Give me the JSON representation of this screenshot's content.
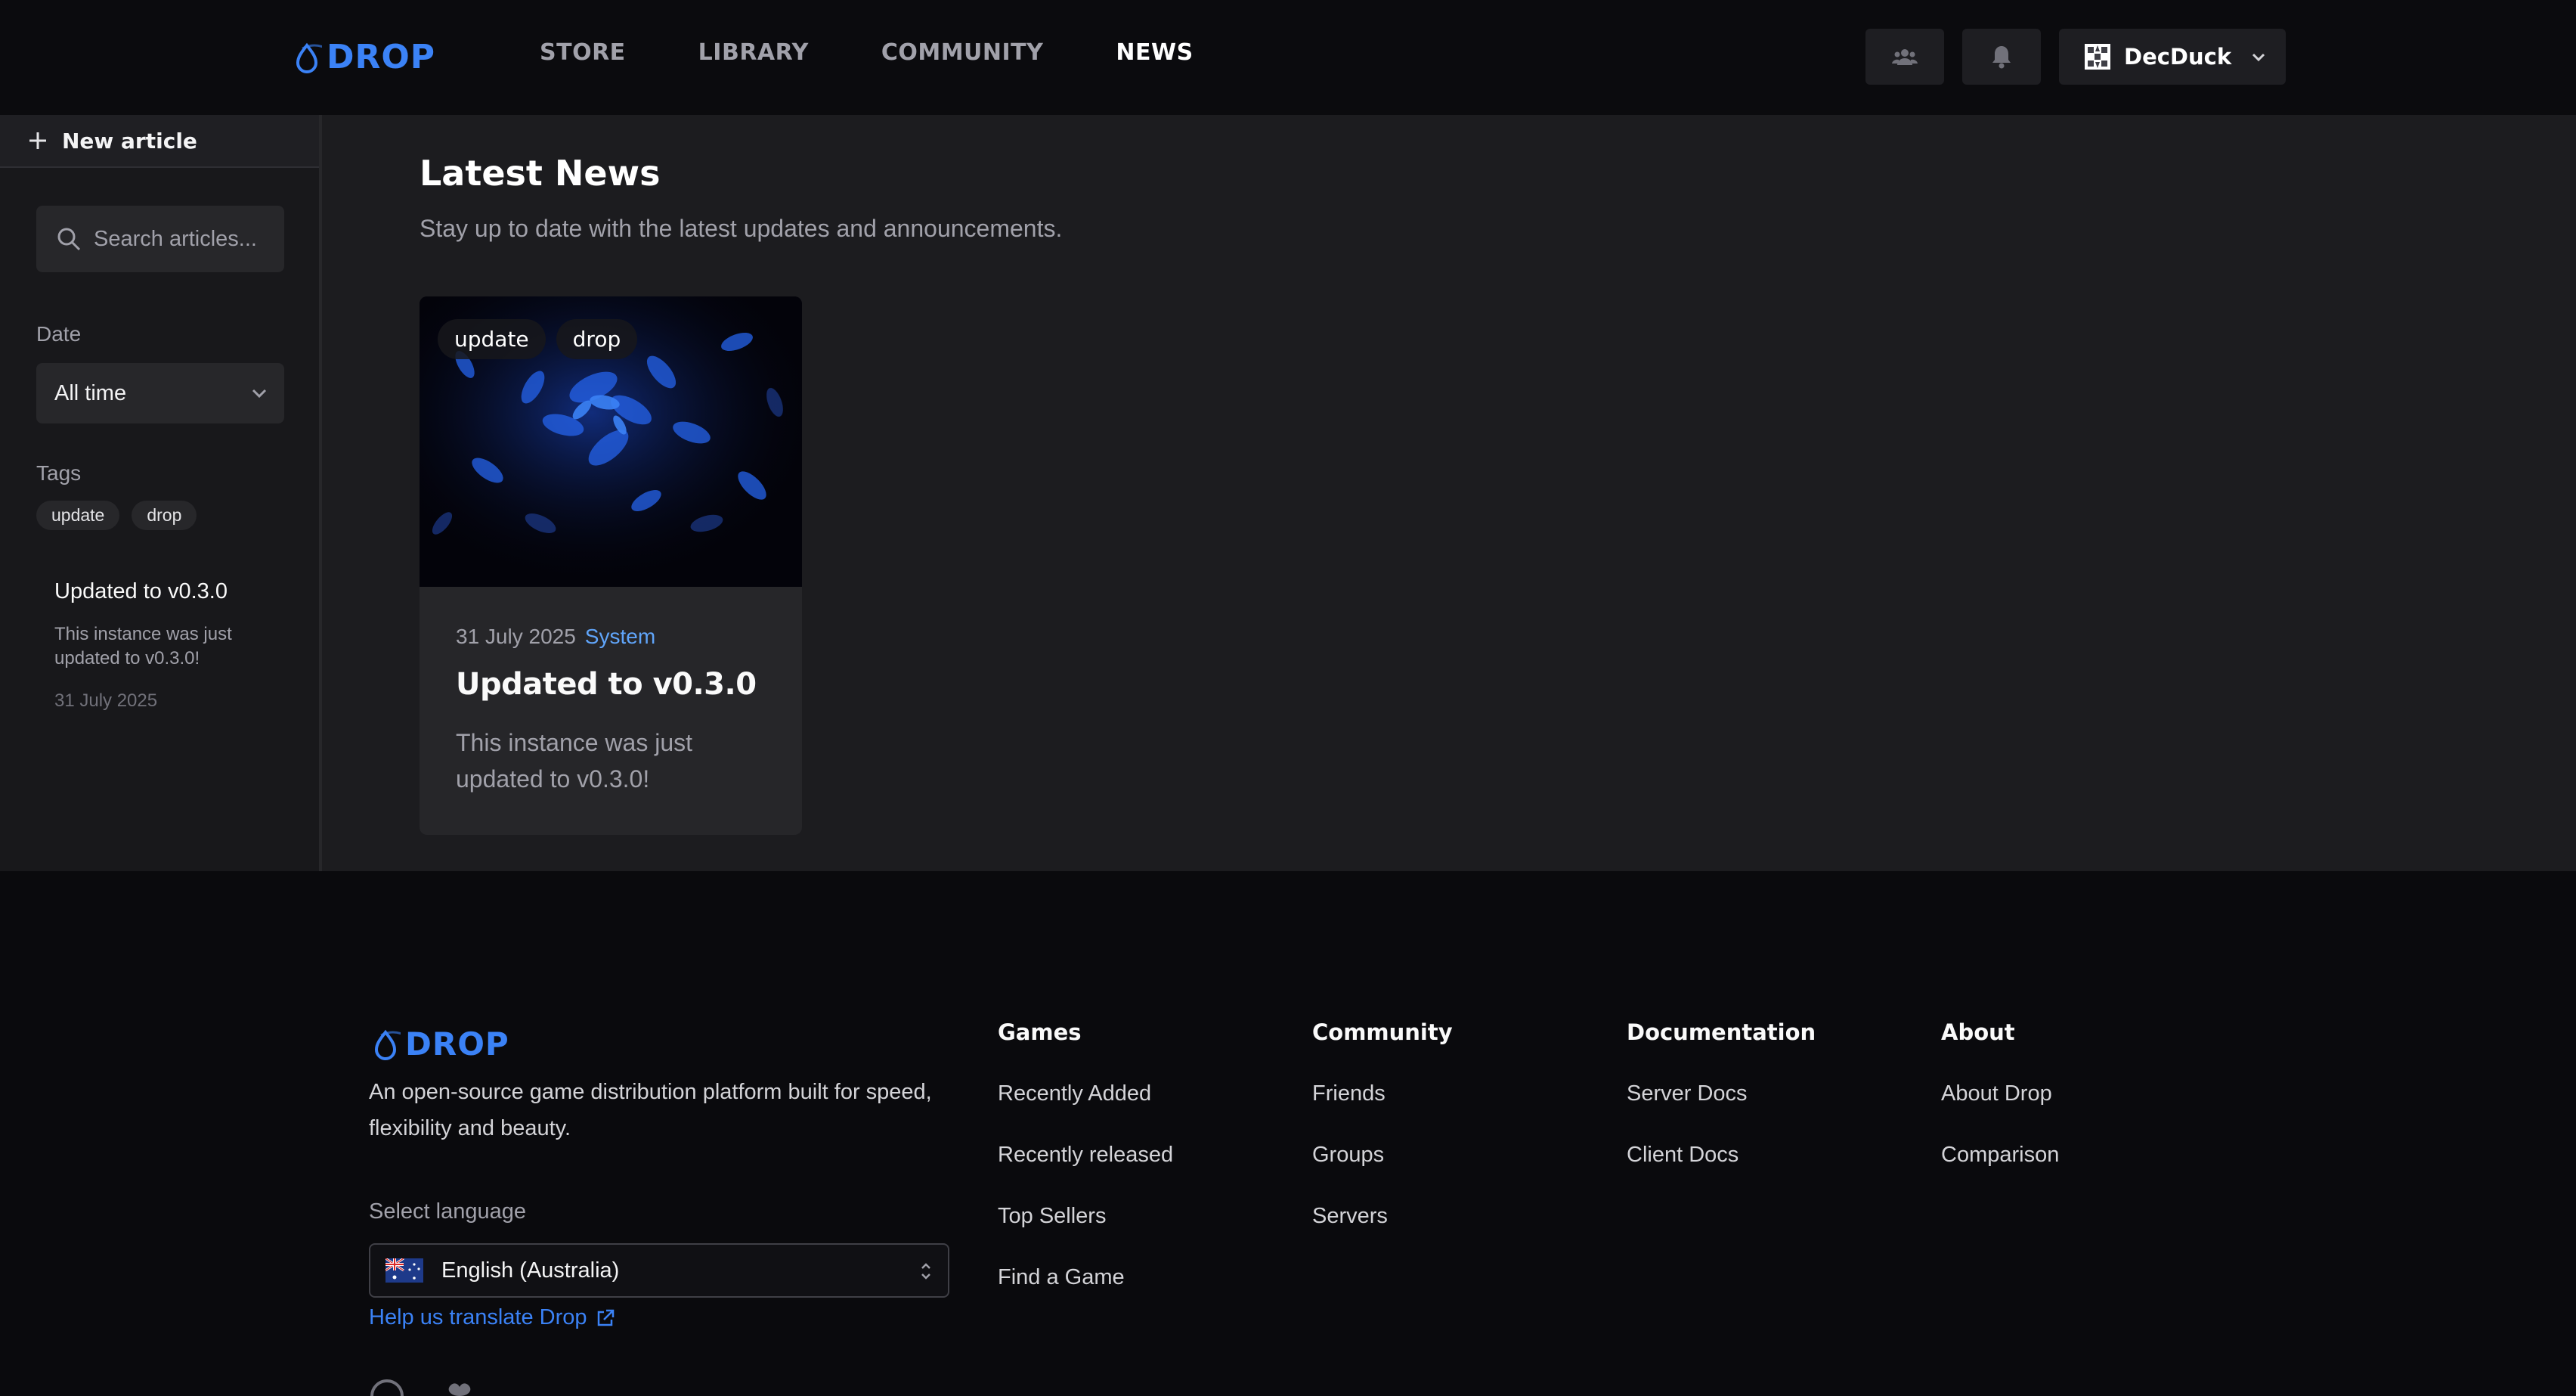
{
  "header": {
    "logo_text": "DROP",
    "nav": [
      "STORE",
      "LIBRARY",
      "COMMUNITY",
      "NEWS"
    ],
    "active_nav": "NEWS",
    "user": {
      "name": "DecDuck"
    }
  },
  "sidebar": {
    "new_article_label": "New article",
    "search_placeholder": "Search articles...",
    "date_label": "Date",
    "date_value": "All time",
    "tags_label": "Tags",
    "tags": [
      "update",
      "drop"
    ],
    "articles": [
      {
        "title": "Updated to v0.3.0",
        "description": "This instance was just updated to v0.3.0!",
        "date": "31 July 2025"
      }
    ]
  },
  "main": {
    "title": "Latest News",
    "subtitle": "Stay up to date with the latest updates and announcements.",
    "cards": [
      {
        "tags": [
          "update",
          "drop"
        ],
        "date": "31 July 2025",
        "author": "System",
        "title": "Updated to v0.3.0",
        "description": "This instance was just updated to v0.3.0!"
      }
    ]
  },
  "footer": {
    "logo_text": "DROP",
    "tagline": "An open-source game distribution platform built for speed, flexibility and beauty.",
    "language_label": "Select language",
    "language_value": "English (Australia)",
    "translate_link": "Help us translate Drop",
    "columns": [
      {
        "heading": "Games",
        "links": [
          "Recently Added",
          "Recently released",
          "Top Sellers",
          "Find a Game"
        ]
      },
      {
        "heading": "Community",
        "links": [
          "Friends",
          "Groups",
          "Servers"
        ]
      },
      {
        "heading": "Documentation",
        "links": [
          "Server Docs",
          "Client Docs"
        ]
      },
      {
        "heading": "About",
        "links": [
          "About Drop",
          "Comparison"
        ]
      }
    ]
  },
  "colors": {
    "accent": "#3b82f6",
    "link": "#60a5fa",
    "background": "#0a0a0d",
    "panel": "#1c1c1f"
  }
}
